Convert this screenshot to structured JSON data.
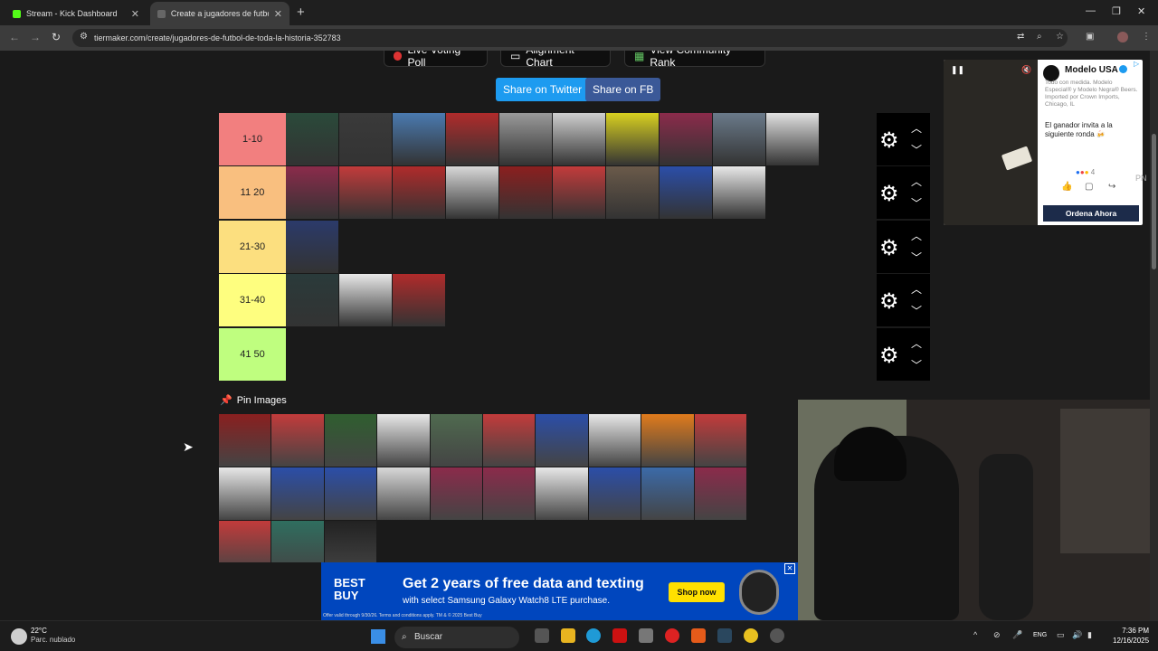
{
  "browser": {
    "tabs": [
      {
        "title": "Stream - Kick Dashboard",
        "active": false
      },
      {
        "title": "Create a jugadores de futbol de",
        "active": true
      }
    ],
    "url": "tiermaker.com/create/jugadores-de-futbol-de-toda-la-historia-352783"
  },
  "page": {
    "top_buttons": [
      "Live Voting Poll",
      "Alignment Chart",
      "View Community Rank"
    ],
    "share": {
      "twitter": "Share on Twitter",
      "fb": "Share on FB"
    },
    "tiers": [
      {
        "label": "1-10",
        "color": "#f27f7f",
        "count": 10
      },
      {
        "label": "11 20",
        "color": "#f9bf7f",
        "count": 9
      },
      {
        "label": "21-30",
        "color": "#fcdf7f",
        "count": 1
      },
      {
        "label": "31-40",
        "color": "#fefe7f",
        "count": 3
      },
      {
        "label": "41 50",
        "color": "#bffe7f",
        "count": 0
      }
    ],
    "pin_label": "Pin Images",
    "pool_count": 23,
    "pool_colors": [
      "#8a1f1f",
      "#c23b3b",
      "#2f5e2f",
      "#e8e8e8",
      "#4f6a4f",
      "#c23b3b",
      "#2b4ea8",
      "#e8e8e8",
      "#e07b1c",
      "#c23b3b",
      "#e8e8e8",
      "#2b4ea8",
      "#2b4ea8",
      "#d8d8d8",
      "#8b2b4b",
      "#8b2b4b",
      "#e8e8e8",
      "#2b4ea8",
      "#3b6aa8",
      "#8b2b4b",
      "#c23b3b",
      "#2f6e5f",
      "#222222"
    ],
    "tier_image_colors": [
      [
        "#2a4a3a",
        "#3a3a3a",
        "#4a7ab0",
        "#b02b2b",
        "#9a9a9a",
        "#cfcfcf",
        "#d8d020",
        "#8b2b4b",
        "#6a7a8a",
        "#e0e0e0"
      ],
      [
        "#8b2b4b",
        "#c23b3b",
        "#b02b2b",
        "#d8d8d8",
        "#8b1f1f",
        "#c23b3b",
        "#6a5a4a",
        "#2b4ea8",
        "#e8e8e8"
      ],
      [
        "#2b3a6a"
      ],
      [
        "#2a3a3a",
        "#e8e8e8",
        "#b02b2b"
      ],
      []
    ]
  },
  "ad_side": {
    "brand": "Modelo USA",
    "description": "Todo con medida. Modelo Especial® y Modelo Negra® Beers. Imported por Crown Imports, Chicago, IL",
    "message": "El ganador invita a la siguiente ronda 🍻",
    "reactions": "4",
    "cta": "Ordena Ahora",
    "badge": "PN"
  },
  "banner_ad": {
    "logo": "BEST BUY",
    "headline": "Get 2 years of free data and texting",
    "sub": "with select Samsung Galaxy Watch8 LTE purchase.",
    "fine": "Offer valid through 9/30/26. Terms and conditions apply. TM & © 2025 Best Buy",
    "cta": "Shop now"
  },
  "taskbar": {
    "temp": "22°C",
    "weather": "Parc. nublado",
    "search": "Buscar",
    "lang": "ENG",
    "time": "7:36 PM",
    "date": "12/16/2025"
  },
  "icons": [
    "kick-icon",
    "tiermaker-icon",
    "back-icon",
    "forward-icon",
    "reload-icon",
    "settings-icon",
    "windows-icon"
  ]
}
